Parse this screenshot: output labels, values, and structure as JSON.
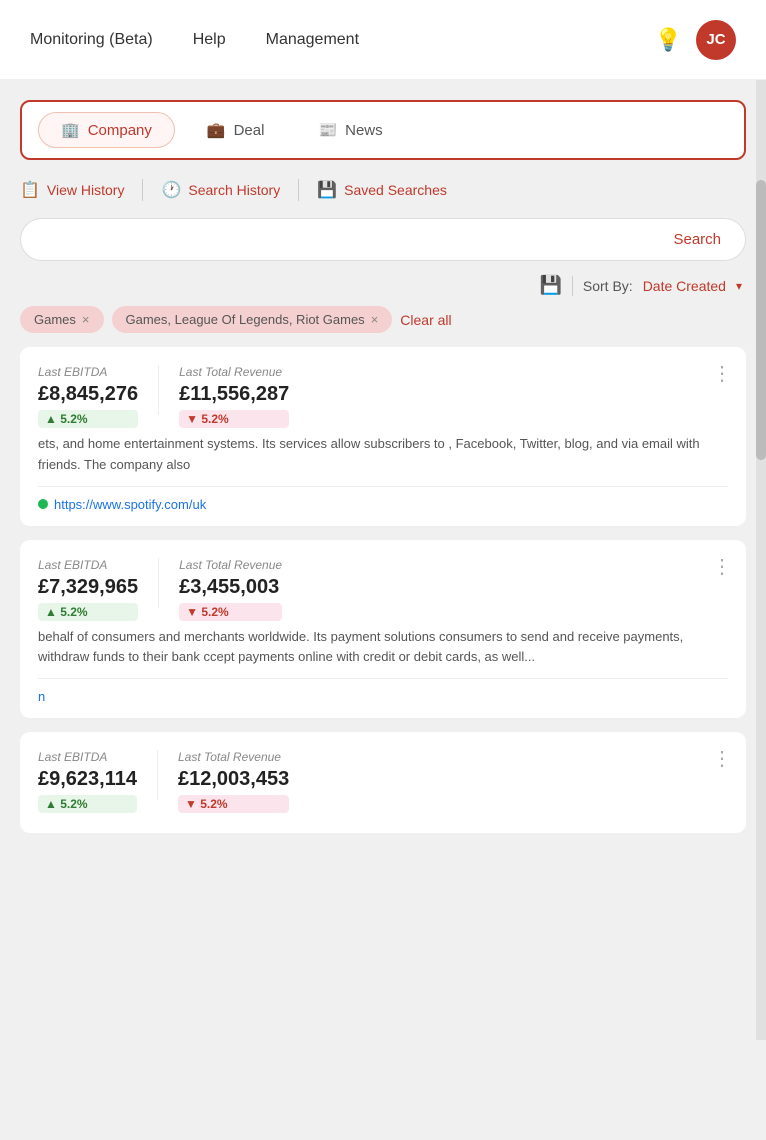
{
  "nav": {
    "links": [
      "Monitoring (Beta)",
      "Help",
      "Management"
    ],
    "avatar_initials": "JC"
  },
  "search_types": [
    {
      "id": "company",
      "label": "Company",
      "icon": "🏢",
      "active": true
    },
    {
      "id": "deal",
      "label": "Deal",
      "icon": "💼",
      "active": false
    },
    {
      "id": "news",
      "label": "News",
      "icon": "📰",
      "active": false
    }
  ],
  "history_items": [
    {
      "id": "view-history",
      "label": "View History",
      "icon": "📋"
    },
    {
      "id": "search-history",
      "label": "Search History",
      "icon": "🕐"
    },
    {
      "id": "saved-searches",
      "label": "Saved Searches",
      "icon": "💾"
    }
  ],
  "search": {
    "placeholder": "",
    "button_label": "Search"
  },
  "sort": {
    "label": "Sort By:",
    "value": "Date Created"
  },
  "filter_chips": [
    {
      "id": "chip1",
      "label": "Games",
      "removable": true
    },
    {
      "id": "chip2",
      "label": "Games, League Of Legends, Riot Games",
      "removable": true
    }
  ],
  "clear_all_label": "Clear all",
  "results": [
    {
      "id": "result1",
      "last_ebitda_label": "Last EBITDA",
      "last_ebitda_value": "£8,845,276",
      "ebitda_badge": "▲ 5.2%",
      "ebitda_badge_type": "green",
      "last_revenue_label": "Last Total Revenue",
      "last_revenue_value": "£11,556,287",
      "revenue_badge": "▼ 5.2%",
      "revenue_badge_type": "red",
      "description": "ets, and home entertainment systems. Its services allow subscribers to , Facebook, Twitter, blog, and via email with friends. The company also",
      "link": "https://www.spotify.com/uk",
      "has_link_dot": true
    },
    {
      "id": "result2",
      "last_ebitda_label": "Last EBITDA",
      "last_ebitda_value": "£7,329,965",
      "ebitda_badge": "▲ 5.2%",
      "ebitda_badge_type": "green",
      "last_revenue_label": "Last Total Revenue",
      "last_revenue_value": "£3,455,003",
      "revenue_badge": "▼ 5.2%",
      "revenue_badge_type": "red",
      "description": "behalf of consumers and merchants worldwide. Its payment solutions consumers to send and receive payments, withdraw funds to their bank ccept payments online with credit or debit cards, as well...",
      "link": "n",
      "has_link_dot": false
    },
    {
      "id": "result3",
      "last_ebitda_label": "Last EBITDA",
      "last_ebitda_value": "£9,623,114",
      "ebitda_badge": "▲ 5.2%",
      "ebitda_badge_type": "green",
      "last_revenue_label": "Last Total Revenue",
      "last_revenue_value": "£12,003,453",
      "revenue_badge": "▼ 5.2%",
      "revenue_badge_type": "red",
      "description": "",
      "link": "",
      "has_link_dot": false
    }
  ]
}
